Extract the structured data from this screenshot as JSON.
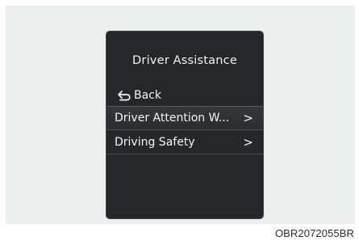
{
  "screen": {
    "title": "Driver Assistance",
    "back_label": "Back",
    "menu": [
      {
        "label": "Driver Attention W...",
        "chevron": ">"
      },
      {
        "label": "Driving Safety",
        "chevron": ">"
      }
    ]
  },
  "caption": "OBR2072055BR",
  "colors": {
    "background": "#eceded",
    "screen": "#262729",
    "text": "#f4f4f4"
  }
}
